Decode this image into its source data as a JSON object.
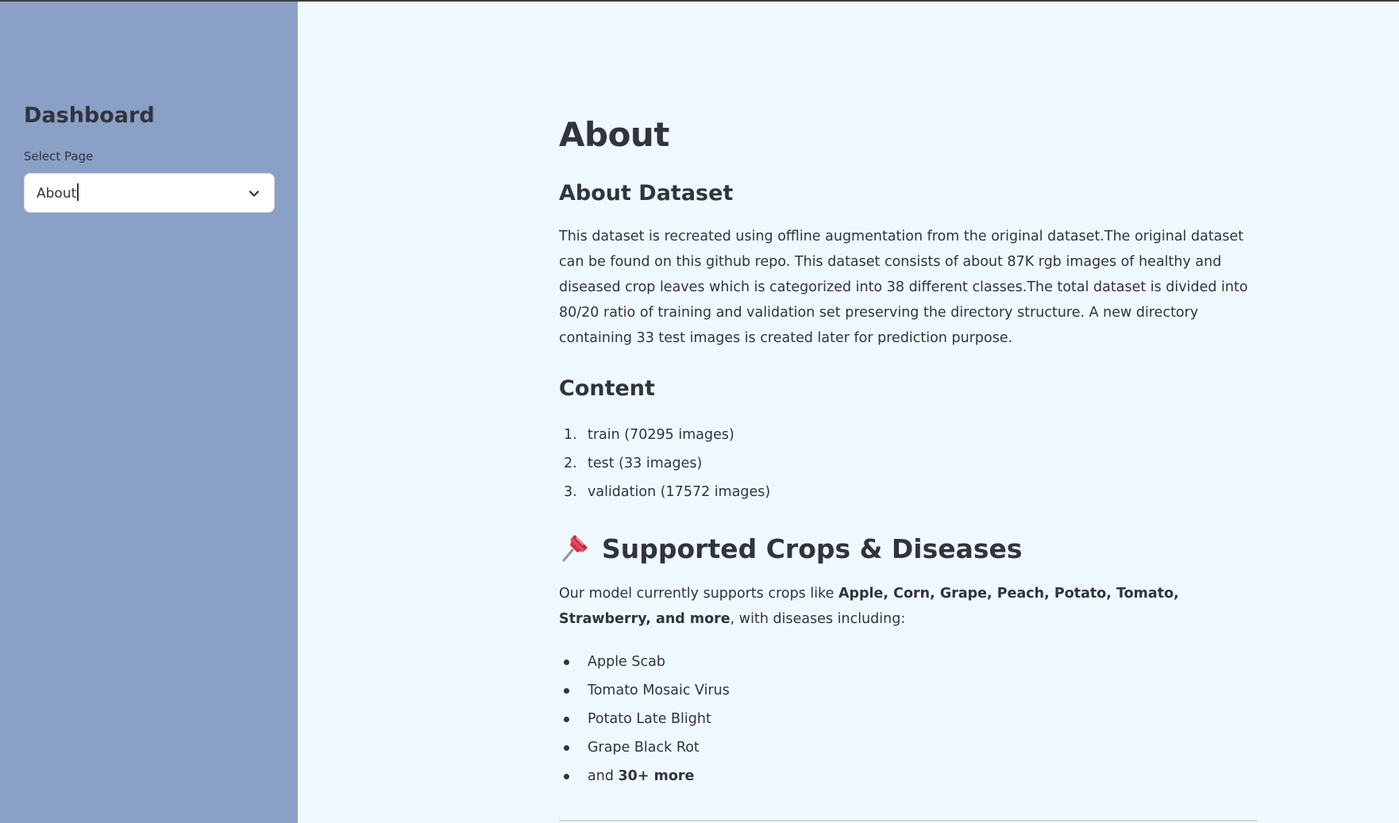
{
  "sidebar": {
    "title": "Dashboard",
    "select_label": "Select Page",
    "select_value": "About"
  },
  "main": {
    "title": "About",
    "dataset_heading": "About Dataset",
    "dataset_text": "This dataset is recreated using offline augmentation from the original dataset.The original dataset can be found on this github repo. This dataset consists of about 87K rgb images of healthy and diseased crop leaves which is categorized into 38 different classes.The total dataset is divided into 80/20 ratio of training and validation set preserving the directory structure. A new directory containing 33 test images is created later for prediction purpose.",
    "content_heading": "Content",
    "content_items": [
      {
        "num": "1.",
        "text": "train (70295 images)"
      },
      {
        "num": "2.",
        "text": "test (33 images)"
      },
      {
        "num": "3.",
        "text": "validation (17572 images)"
      }
    ],
    "crops_icon": "pushpin-icon",
    "crops_heading": "Supported Crops & Diseases",
    "crops_intro_prefix": "Our model currently supports crops like ",
    "crops_intro_bold": "Apple, Corn, Grape, Peach, Potato, Tomato, Strawberry, and more",
    "crops_intro_suffix": ", with diseases including:",
    "diseases": [
      "Apple Scab",
      "Tomato Mosaic Virus",
      "Potato Late Blight",
      "Grape Black Rot"
    ],
    "more_prefix": "and ",
    "more_bold": "30+ more"
  },
  "colors": {
    "sidebar_bg": "#8aa0c6",
    "main_bg": "#eff8ff",
    "text": "#31333f"
  }
}
